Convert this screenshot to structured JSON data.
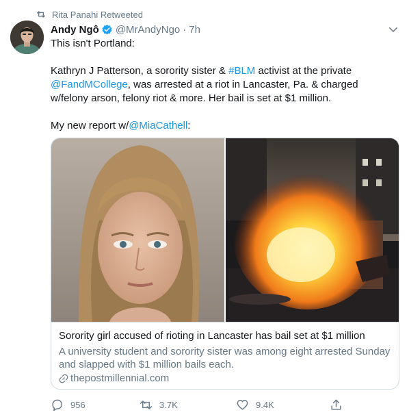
{
  "retweet": {
    "icon": "retweet-icon",
    "label": "Rita Panahi Retweeted"
  },
  "author": {
    "name": "Andy Ngô",
    "handle": "@MrAndyNgo",
    "time": "7h",
    "verified_color": "#1da1f2"
  },
  "tweet": {
    "line1": "This isn't Portland:",
    "p2_before": "Kathryn J Patterson, a sorority sister & ",
    "p2_hashtag": "#BLM",
    "p2_mid": " activist at the private ",
    "p2_mention": "@FandMCollege",
    "p2_after": ", was arrested at a riot in Lancaster, Pa. & charged w/felony arson, felony riot & more. Her bail is set at $1 million.",
    "p3_before": "My new report w/",
    "p3_mention": "@MiaCathell",
    "p3_after": ":",
    "link_color": "#1b95e0"
  },
  "card": {
    "title": "Sorority girl accused of rioting in Lancaster has bail set at $1 million",
    "description": "A university student and sorority sister was among eight arrested Sunday and slapped with $1 million bails each.",
    "domain": "thepostmillennial.com"
  },
  "actions": {
    "reply": {
      "icon": "reply-icon",
      "count": "956"
    },
    "retweet": {
      "icon": "retweet-icon",
      "count": "3.7K"
    },
    "like": {
      "icon": "heart-icon",
      "count": "9.4K"
    },
    "share": {
      "icon": "share-icon"
    }
  }
}
